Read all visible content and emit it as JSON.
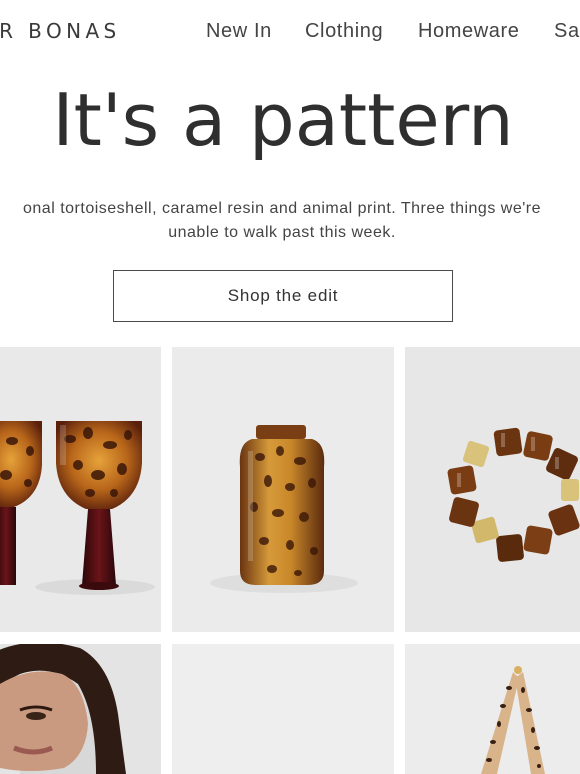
{
  "header": {
    "brand": "VER BONAS",
    "nav": {
      "new_in": "New In",
      "clothing": "Clothing",
      "homeware": "Homeware",
      "sale": "Sa"
    }
  },
  "hero": {
    "title": "It's a pattern",
    "copy_line_1": "onal tortoiseshell, caramel resin and animal print. Three things we're",
    "copy_line_2": "unable to walk past this week.",
    "cta_label": "Shop the edit"
  },
  "products": [
    {
      "icon": "tortoiseshell-wine-glasses-image"
    },
    {
      "icon": "tortoiseshell-vase-image"
    },
    {
      "icon": "resin-bead-bracelet-image"
    },
    {
      "icon": "model-portrait-image"
    },
    {
      "icon": "blank-product-image"
    },
    {
      "icon": "leopard-print-bag-image"
    }
  ],
  "colors": {
    "background": "#ffffff",
    "text": "#333333",
    "tile_background": "#ececec",
    "tortoise_amber": "#c8861e",
    "tortoise_dark": "#3a1608",
    "glass_stem": "#4a0e12"
  }
}
